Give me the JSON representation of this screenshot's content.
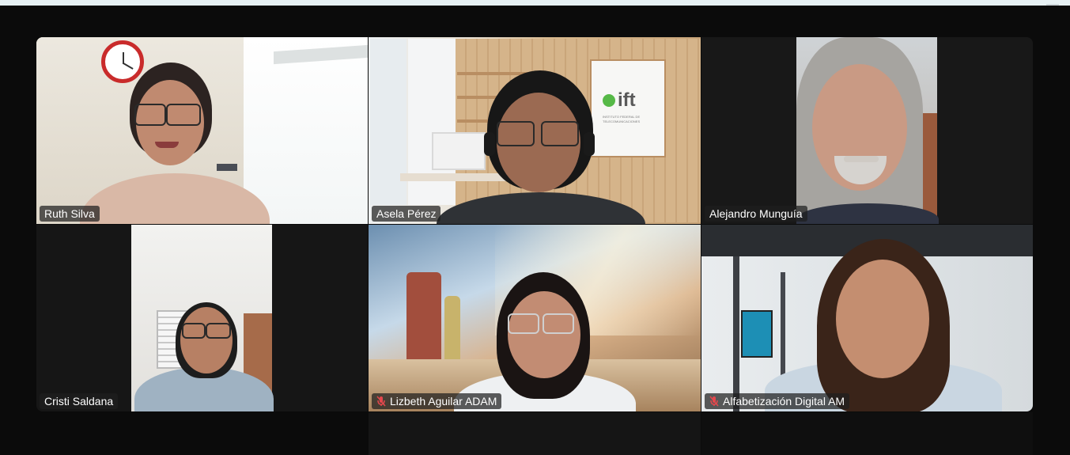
{
  "meeting": {
    "participants": [
      {
        "name": "Ruth Silva",
        "muted": false,
        "active": false
      },
      {
        "name": "Asela Pérez",
        "muted": false,
        "active": true
      },
      {
        "name": "Alejandro Munguía",
        "muted": false,
        "active": false
      },
      {
        "name": "Cristi Saldana",
        "muted": false,
        "active": false
      },
      {
        "name": "Lizbeth Aguilar ADAM",
        "muted": true,
        "active": false
      },
      {
        "name": "Alfabetización Digital AM",
        "muted": true,
        "active": false
      }
    ],
    "background_logo": {
      "brand": "ift",
      "subtitle": "INSTITUTO FEDERAL DE TELECOMUNICACIONES"
    }
  },
  "colors": {
    "active_speaker_border": "#2fe07a",
    "muted_icon": "#e5484d",
    "background": "#0b0b0b"
  },
  "icons": {
    "muted": "microphone-muted-icon"
  }
}
